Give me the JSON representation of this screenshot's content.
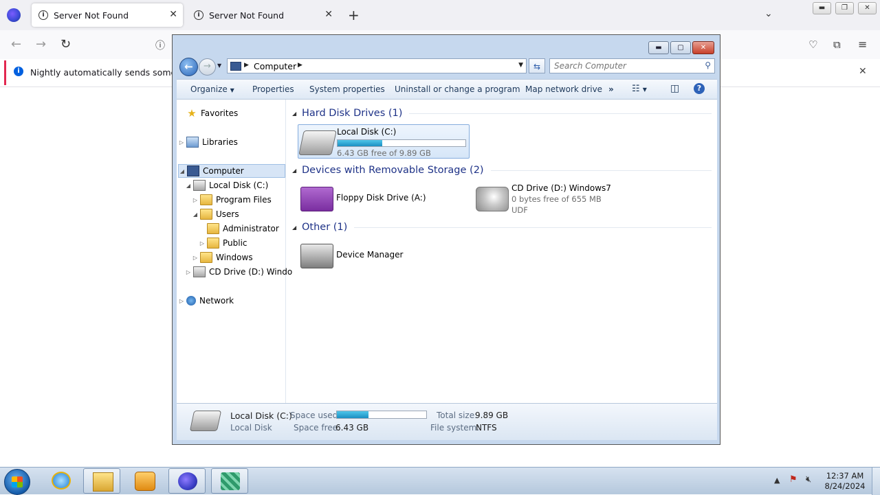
{
  "firefox": {
    "tabs": [
      {
        "label": "Server Not Found",
        "active": true
      },
      {
        "label": "Server Not Found",
        "active": false
      }
    ],
    "notification": "Nightly automatically sends some data"
  },
  "explorer": {
    "address": {
      "path": "Computer"
    },
    "search": {
      "placeholder": "Search Computer"
    },
    "commands": [
      "Organize",
      "Properties",
      "System properties",
      "Uninstall or change a program",
      "Map network drive"
    ],
    "overflow": "»",
    "nav": {
      "favorites": "Favorites",
      "libraries": "Libraries",
      "computer": "Computer",
      "local_disk": "Local Disk (C:)",
      "program_files": "Program Files",
      "users": "Users",
      "administrator": "Administrator",
      "public": "Public",
      "windows": "Windows",
      "cd_drive": "CD Drive (D:) Windo",
      "network": "Network"
    },
    "groups": {
      "hdd": "Hard Disk Drives (1)",
      "removable": "Devices with Removable Storage (2)",
      "other": "Other (1)"
    },
    "drives": {
      "local": {
        "name": "Local Disk (C:)",
        "free": "6.43 GB free of 9.89 GB",
        "used_fraction": 0.35
      },
      "floppy": {
        "name": "Floppy Disk Drive (A:)"
      },
      "cd": {
        "name": "CD Drive (D:) Windows7",
        "free": "0 bytes free of 655 MB",
        "fs": "UDF"
      },
      "devmgr": {
        "name": "Device Manager"
      }
    },
    "details": {
      "name": "Local Disk (C:)",
      "type": "Local Disk",
      "space_used_label": "Space used:",
      "space_free_label": "Space free:",
      "space_free": "6.43 GB",
      "total_size_label": "Total size:",
      "total_size": "9.89 GB",
      "file_system_label": "File system:",
      "file_system": "NTFS",
      "used_fraction": 0.35
    }
  },
  "taskbar": {
    "time": "12:37 AM",
    "date": "8/24/2024"
  },
  "colors": {
    "accent_blue": "#1e3287",
    "progress": "#1b8fc2",
    "notice_bar": "#e22850"
  }
}
